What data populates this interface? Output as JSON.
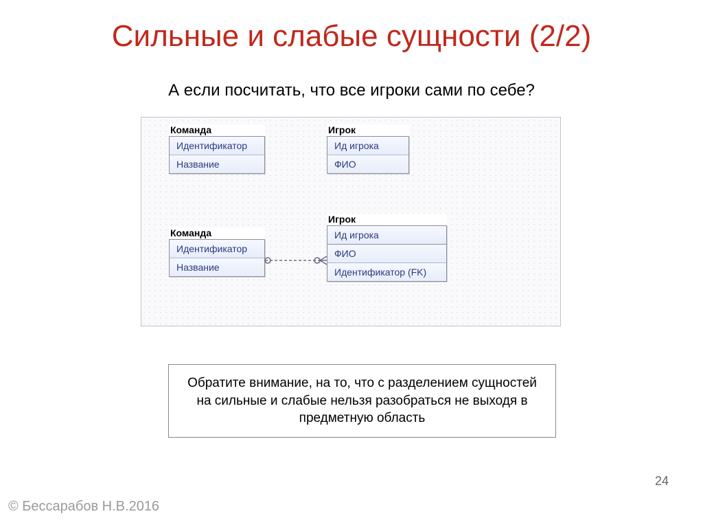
{
  "title": "Сильные и слабые сущности (2/2)",
  "subtitle": "А если посчитать, что все игроки сами по себе?",
  "entities": {
    "team1": {
      "label": "Команда",
      "attrs": [
        "Идентификатор",
        "Название"
      ]
    },
    "player1": {
      "label": "Игрок",
      "attrs": [
        "Ид игрока",
        "ФИО"
      ]
    },
    "team2": {
      "label": "Команда",
      "attrs": [
        "Идентификатор",
        "Название"
      ]
    },
    "player2": {
      "label": "Игрок",
      "pk": [
        "Ид игрока"
      ],
      "attrs": [
        "ФИО",
        "Идентификатор (FK)"
      ]
    }
  },
  "note": "Обратите внимание, на то, что с разделением сущностей на сильные и слабые нельзя разобраться не выходя в предметную область",
  "page_number": "24",
  "copyright": "© Бессарабов Н.В.2016"
}
